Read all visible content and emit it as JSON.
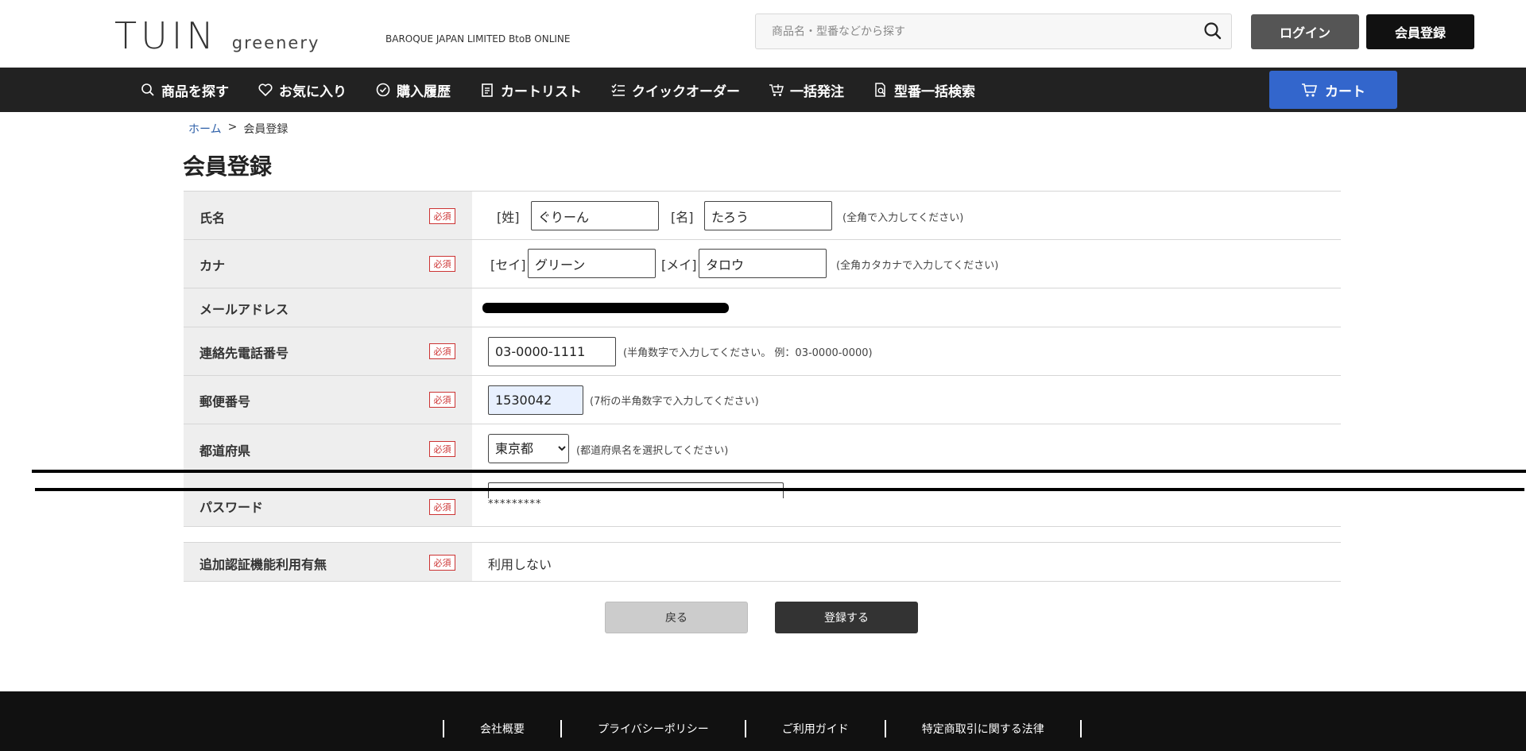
{
  "header": {
    "logo_main": "TUIN",
    "logo_sub": "greenery",
    "tagline": "BAROQUE JAPAN LIMITED BtoB ONLINE",
    "search_placeholder": "商品名・型番などから探す",
    "login_label": "ログイン",
    "register_label": "会員登録"
  },
  "nav": {
    "items": [
      {
        "label": "商品を探す",
        "icon": "search-icon"
      },
      {
        "label": "お気に入り",
        "icon": "heart-icon"
      },
      {
        "label": "購入履歴",
        "icon": "clock-icon"
      },
      {
        "label": "カートリスト",
        "icon": "clipboard-icon"
      },
      {
        "label": "クイックオーダー",
        "icon": "checklist-icon"
      },
      {
        "label": "一括発注",
        "icon": "cart-upload-icon"
      },
      {
        "label": "型番一括検索",
        "icon": "document-search-icon"
      }
    ],
    "cart_label": "カート",
    "bg_color": "#222222",
    "cart_color": "#3366cc"
  },
  "breadcrumb": {
    "home": "ホーム",
    "separator": ">",
    "current": "会員登録"
  },
  "page_title": "会員登録",
  "required_badge": "必須",
  "form": {
    "name": {
      "label": "氏名",
      "last_tag": "[姓]",
      "last_value": "ぐりーん",
      "first_tag": "[名]",
      "first_value": "たろう",
      "hint": "(全角で入力してください)"
    },
    "kana": {
      "label": "カナ",
      "last_tag": "[セイ]",
      "last_value": "グリーン",
      "first_tag": "[メイ]",
      "first_value": "タロウ",
      "hint": "(全角カタカナで入力してください)"
    },
    "email": {
      "label": "メールアドレス"
    },
    "phone": {
      "label": "連絡先電話番号",
      "value": "03-0000-1111",
      "hint": "(半角数字で入力してください。 例：03-0000-0000)"
    },
    "postal": {
      "label": "郵便番号",
      "value": "1530042",
      "hint": "(7桁の半角数字で入力してください)"
    },
    "prefecture": {
      "label": "都道府県",
      "value": "東京都",
      "hint": "(都道府県名を選択してください)"
    },
    "password": {
      "label": "パスワード",
      "value": "*********"
    },
    "two_factor": {
      "label": "追加認証機能利用有無",
      "value": "利用しない"
    }
  },
  "buttons": {
    "back": "戻る",
    "submit": "登録する"
  },
  "footer": {
    "links": [
      "会社概要",
      "プライバシーポリシー",
      "ご利用ガイド",
      "特定商取引に関する法律"
    ]
  }
}
